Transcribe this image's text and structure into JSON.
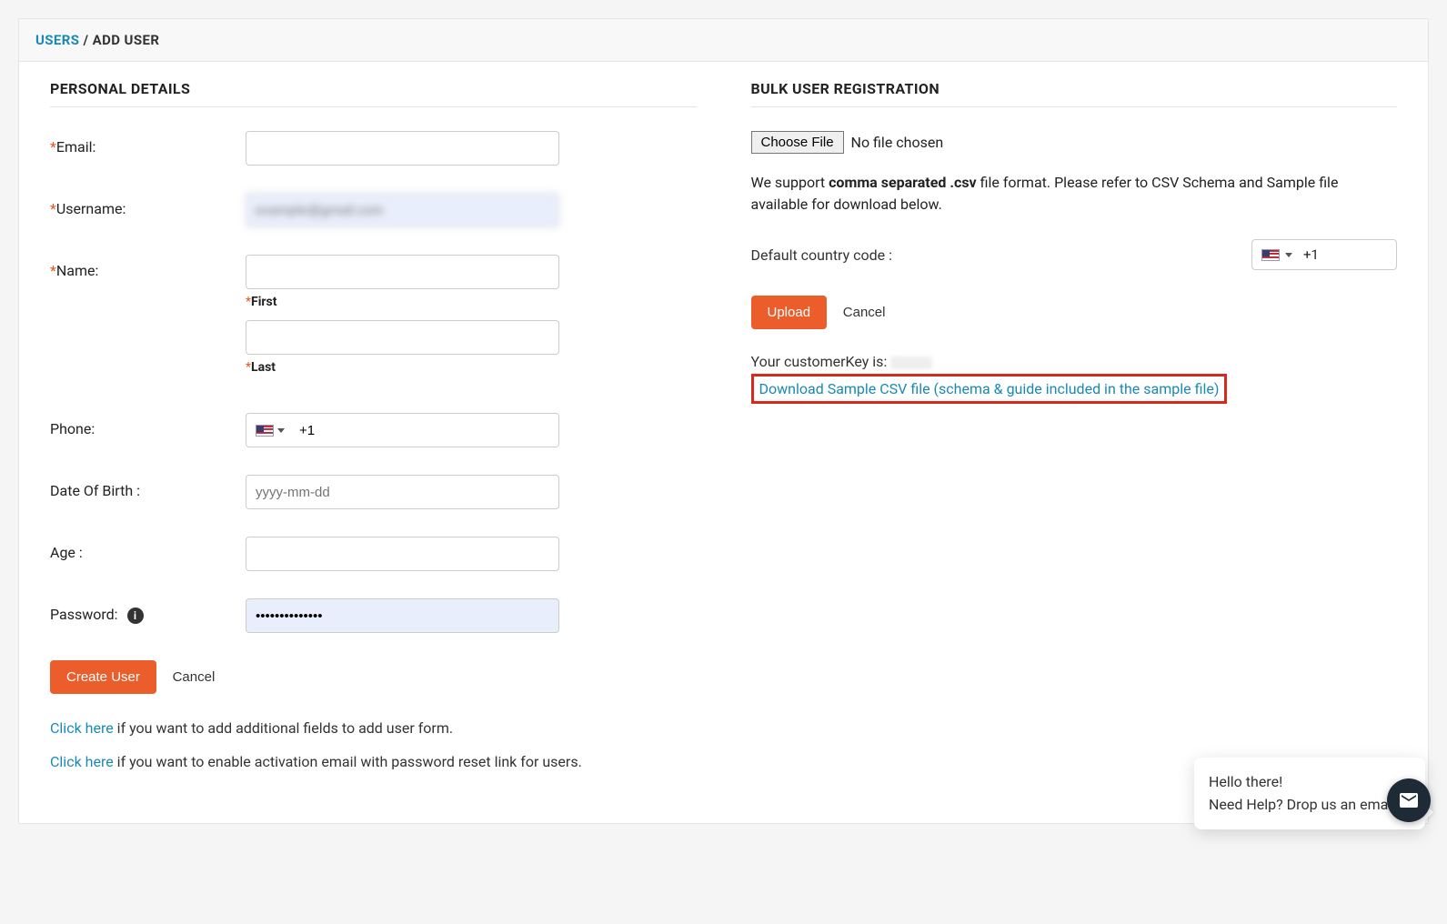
{
  "breadcrumb": {
    "link": "USERS",
    "sep": "/",
    "current": "ADD USER"
  },
  "left": {
    "title": "PERSONAL DETAILS",
    "email_label": "Email:",
    "email_value": "",
    "username_label": "Username:",
    "username_value": "example@gmail.com",
    "name_label": "Name:",
    "first_value": "",
    "first_sublabel": "First",
    "last_value": "",
    "last_sublabel": "Last",
    "phone_label": "Phone:",
    "phone_dial": "+1",
    "phone_value": "",
    "dob_label": "Date Of Birth :",
    "dob_placeholder": "yyyy-mm-dd",
    "dob_value": "",
    "age_label": "Age :",
    "age_value": "",
    "password_label": "Password:",
    "password_value": "••••••••••••••",
    "create_btn": "Create User",
    "cancel_btn": "Cancel",
    "hint1_link": "Click here",
    "hint1_rest": " if you want to add additional fields to add user form.",
    "hint2_link": "Click here",
    "hint2_rest": " if you want to enable activation email with password reset link for users."
  },
  "right": {
    "title": "BULK USER REGISTRATION",
    "choose_file": "Choose File",
    "no_file": "No file chosen",
    "support_a": "We support ",
    "support_b": "comma separated .csv",
    "support_c": " file format. Please refer to CSV Schema and Sample file available for download below.",
    "cc_label": "Default country code :",
    "cc_dial": "+1",
    "upload_btn": "Upload",
    "cancel_btn": "Cancel",
    "ck_label": "Your customerKey is: ",
    "dl_link": "Download Sample CSV file (schema & guide included in the sample file)"
  },
  "chat": {
    "line1": "Hello there!",
    "line2": "Need Help? Drop us an email !"
  }
}
